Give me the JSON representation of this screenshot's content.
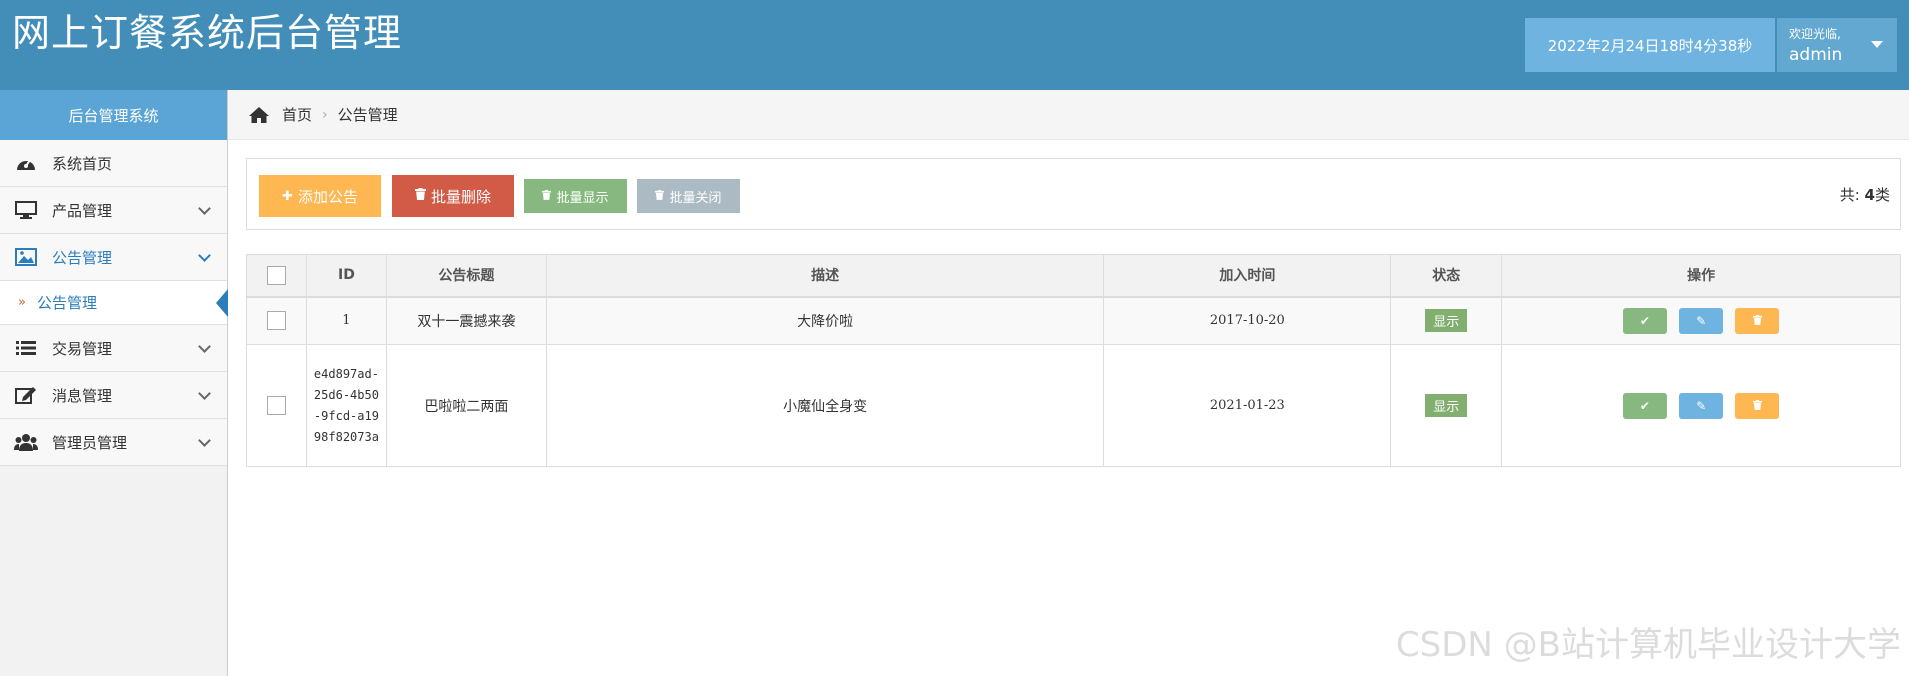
{
  "header": {
    "title": "网上订餐系统后台管理",
    "datetime": "2022年2月24日18时4分38秒",
    "welcome": "欢迎光临,",
    "username": "admin"
  },
  "sidebar": {
    "title": "后台管理系统",
    "items": [
      {
        "label": "系统首页",
        "icon": "dashboard-icon"
      },
      {
        "label": "产品管理",
        "icon": "desktop-icon"
      },
      {
        "label": "公告管理",
        "icon": "picture-icon"
      },
      {
        "label": "交易管理",
        "icon": "list-icon"
      },
      {
        "label": "消息管理",
        "icon": "edit-icon"
      },
      {
        "label": "管理员管理",
        "icon": "users-icon"
      }
    ],
    "active_sub": "公告管理"
  },
  "breadcrumb": {
    "home": "首页",
    "separator": "›",
    "current": "公告管理"
  },
  "toolbar": {
    "add_label": "添加公告",
    "batch_delete_label": "批量删除",
    "batch_show_label": "批量显示",
    "batch_close_label": "批量关闭",
    "total_prefix": "共:",
    "total_count": "4",
    "total_suffix": "类"
  },
  "table": {
    "columns": [
      "ID",
      "公告标题",
      "描述",
      "加入时间",
      "状态",
      "操作"
    ],
    "rows": [
      {
        "id": "1",
        "title": "双十一震撼来袭",
        "desc": "大降价啦",
        "date": "2017-10-20",
        "status": "显示"
      },
      {
        "id": "e4d897ad-25d6-4b50-9fcd-a1998f82073a",
        "title": "巴啦啦二两面",
        "desc": "小魔仙全身变",
        "date": "2021-01-23",
        "status": "显示"
      }
    ]
  },
  "watermark": "CSDN @B站计算机毕业设计大学",
  "colors": {
    "header": "#438eb9",
    "sidebar_header": "#5aa4d6",
    "active": "#2b7dbc",
    "success": "#87b87f",
    "danger": "#d15b47",
    "warning": "#ffb752",
    "info": "#6fb3e0",
    "gray": "#abbac3"
  }
}
